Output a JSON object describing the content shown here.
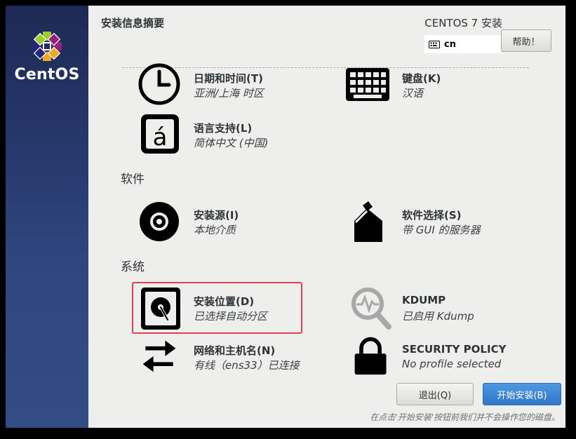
{
  "sidebar": {
    "brand": "CentOS"
  },
  "header": {
    "title": "安装信息摘要",
    "product": "CENTOS 7 安装",
    "keyboard_layout": "cn",
    "help_label": "帮助！"
  },
  "sections": {
    "localization": {
      "items": [
        {
          "name": "日期和时间(T)",
          "status": "亚洲/上海 时区",
          "icon": "clock-icon"
        },
        {
          "name": "键盘(K)",
          "status": "汉语",
          "icon": "keyboard-icon"
        },
        {
          "name": "语言支持(L)",
          "status": "简体中文 (中国)",
          "icon": "language-icon"
        }
      ]
    },
    "software": {
      "label": "软件",
      "items": [
        {
          "name": "安装源(I)",
          "status": "本地介质",
          "icon": "disc-icon"
        },
        {
          "name": "软件选择(S)",
          "status": "带 GUI 的服务器",
          "icon": "package-icon"
        }
      ]
    },
    "system": {
      "label": "系统",
      "items": [
        {
          "name": "安装位置(D)",
          "status": "已选择自动分区",
          "icon": "hard-drive-icon"
        },
        {
          "name": "KDUMP",
          "status": "已启用 Kdump",
          "icon": "kdump-search-icon"
        },
        {
          "name": "网络和主机名(N)",
          "status": "有线（ens33）已连接",
          "icon": "network-arrows-icon"
        },
        {
          "name": "SECURITY POLICY",
          "status": "No profile selected",
          "icon": "padlock-icon"
        }
      ]
    }
  },
  "footer": {
    "quit_label": "退出(Q)",
    "begin_label": "开始安装(B)",
    "note": "在点击'开始安装'按钮前我们并不会操作您的磁盘。"
  },
  "colors": {
    "sidebar": "#27386c",
    "highlight": "#e0414f",
    "primary_button": "#3077c8"
  }
}
